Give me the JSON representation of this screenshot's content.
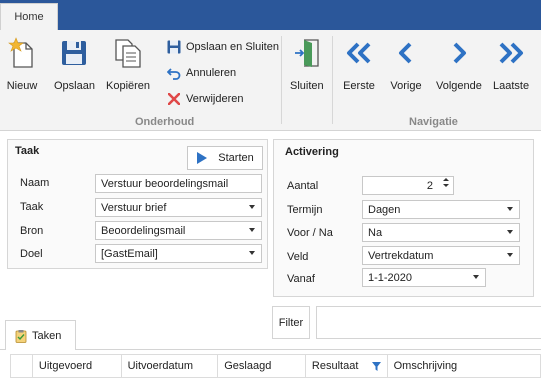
{
  "ribbon": {
    "tab_home": "Home",
    "buttons": {
      "nieuw": "Nieuw",
      "opslaan": "Opslaan",
      "kopieren": "Kopiëren",
      "opslaan_sluiten": "Opslaan en Sluiten",
      "annuleren": "Annuleren",
      "verwijderen": "Verwijderen",
      "sluiten": "Sluiten",
      "eerste": "Eerste",
      "vorige": "Vorige",
      "volgende": "Volgende",
      "laatste": "Laatste"
    },
    "groups": {
      "onderhoud": "Onderhoud",
      "navigatie": "Navigatie"
    }
  },
  "taak": {
    "title": "Taak",
    "start_button": "Starten",
    "fields": {
      "naam_label": "Naam",
      "naam_value": "Verstuur beoordelingsmail",
      "taak_label": "Taak",
      "taak_value": "Verstuur brief",
      "bron_label": "Bron",
      "bron_value": "Beoordelingsmail",
      "doel_label": "Doel",
      "doel_value": "[GastEmail]"
    }
  },
  "activering": {
    "title": "Activering",
    "fields": {
      "aantal_label": "Aantal",
      "aantal_value": "2",
      "termijn_label": "Termijn",
      "termijn_value": "Dagen",
      "voorna_label": "Voor / Na",
      "voorna_value": "Na",
      "veld_label": "Veld",
      "veld_value": "Vertrekdatum",
      "vanaf_label": "Vanaf",
      "vanaf_value": "1-1-2020"
    }
  },
  "bottom": {
    "filter_button": "Filter",
    "filter_value": "",
    "tab_taken": "Taken",
    "columns": [
      "Uitgevoerd",
      "Uitvoerdatum",
      "Geslaagd",
      "Resultaat",
      "Omschrijving"
    ]
  },
  "colors": {
    "accent": "#2b579a",
    "nav_blue": "#2e72c4",
    "delete_red": "#e04848"
  }
}
